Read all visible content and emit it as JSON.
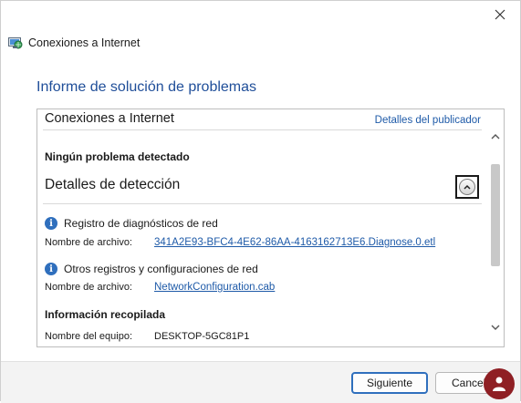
{
  "window": {
    "title": "Conexiones a Internet"
  },
  "page": {
    "heading": "Informe de solución de problemas"
  },
  "report": {
    "section_title": "Conexiones a Internet",
    "publisher_link": "Detalles del publicador",
    "status": "Ningún problema detectado",
    "detection_title": "Detalles de detección",
    "items": [
      {
        "title": "Registro de diagnósticos de red",
        "file_label": "Nombre de archivo:",
        "file_value": "341A2E93-BFC4-4E62-86AA-4163162713E6.Diagnose.0.etl"
      },
      {
        "title": "Otros registros y configuraciones de red",
        "file_label": "Nombre de archivo:",
        "file_value": "NetworkConfiguration.cab"
      }
    ],
    "collected_title": "Información recopilada",
    "computer_label": "Nombre del equipo:",
    "computer_value": "DESKTOP-5GC81P1"
  },
  "footer": {
    "next_label": "Siguiente",
    "cancel_label": "Cancelar"
  },
  "colors": {
    "heading": "#1f4e99",
    "link": "#1e5aa8",
    "primary_border": "#2f6fbd"
  }
}
